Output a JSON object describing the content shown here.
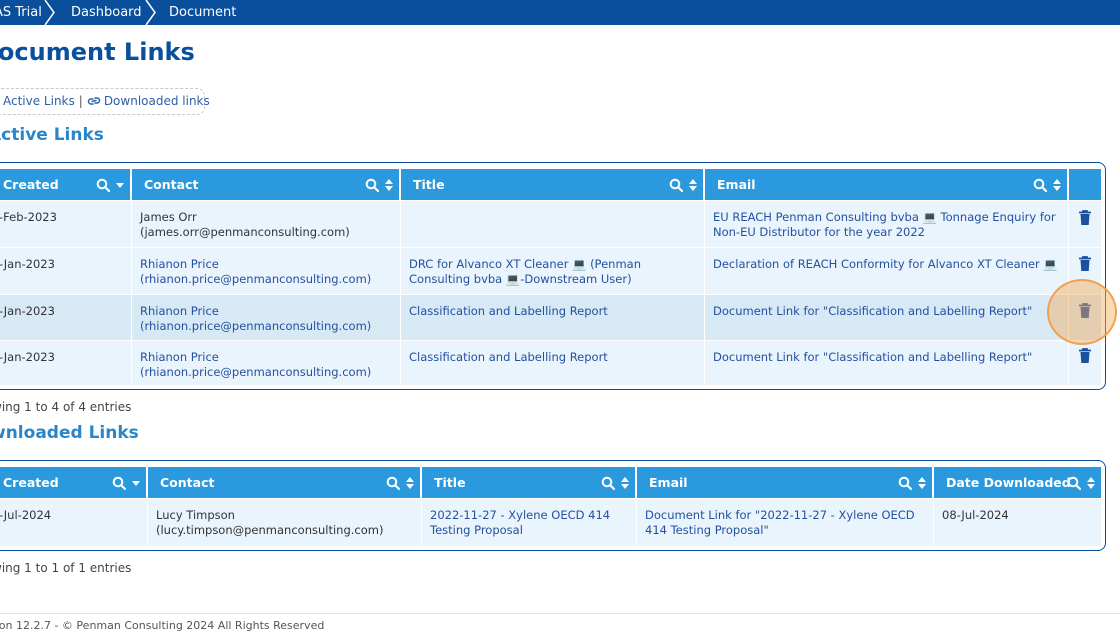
{
  "breadcrumb": {
    "items": [
      "AS Trial",
      "Dashboard",
      "Document"
    ]
  },
  "page": {
    "title": "Document Links"
  },
  "filters": {
    "active_label": "Active Links",
    "separator": "|",
    "downloaded_label": "Downloaded links"
  },
  "active_section": {
    "title": "Active Links",
    "columns": [
      "Created",
      "Contact",
      "Title",
      "Email"
    ],
    "rows": [
      {
        "created": "-Feb-2023",
        "contact": "James Orr (james.orr@penmanconsulting.com)",
        "title": "",
        "email": "EU REACH Penman Consulting bvba 💻 Tonnage Enquiry for Non-EU Distributor for the year 2022"
      },
      {
        "created": "-Jan-2023",
        "contact": "Rhianon Price (rhianon.price@penmanconsulting.com)",
        "title": "DRC for Alvanco XT Cleaner 💻 (Penman Consulting bvba 💻-Downstream User)",
        "email": "Declaration of REACH Conformity for Alvanco XT Cleaner 💻"
      },
      {
        "created": "-Jan-2023",
        "contact": "Rhianon Price (rhianon.price@penmanconsulting.com)",
        "title": "Classification and Labelling Report",
        "email": "Document Link for \"Classification and Labelling Report\""
      },
      {
        "created": "-Jan-2023",
        "contact": "Rhianon Price (rhianon.price@penmanconsulting.com)",
        "title": "Classification and Labelling Report",
        "email": "Document Link for \"Classification and Labelling Report\""
      }
    ],
    "info": "wing 1 to 4 of 4 entries"
  },
  "downloaded_section": {
    "title": "wnloaded Links",
    "columns": [
      "Created",
      "Contact",
      "Title",
      "Email",
      "Date Downloaded"
    ],
    "rows": [
      {
        "created": "-Jul-2024",
        "contact": "Lucy Timpson (lucy.timpson@penmanconsulting.com)",
        "title": "2022-11-27 - Xylene OECD 414 Testing Proposal",
        "email": "Document Link for \"2022-11-27 - Xylene OECD 414 Testing Proposal\"",
        "date_downloaded": "08-Jul-2024"
      }
    ],
    "info": "wing 1 to 1 of 1 entries"
  },
  "footer": {
    "text": "sion 12.2.7 - © Penman Consulting 2024 All Rights Reserved"
  },
  "colors": {
    "brand": "#0a4f9c",
    "header": "#2b99dd",
    "section_title": "#2a86c9",
    "row": "#eaf4fc",
    "row_alt": "#d8e9f6",
    "highlight": "#f5aa5a"
  }
}
